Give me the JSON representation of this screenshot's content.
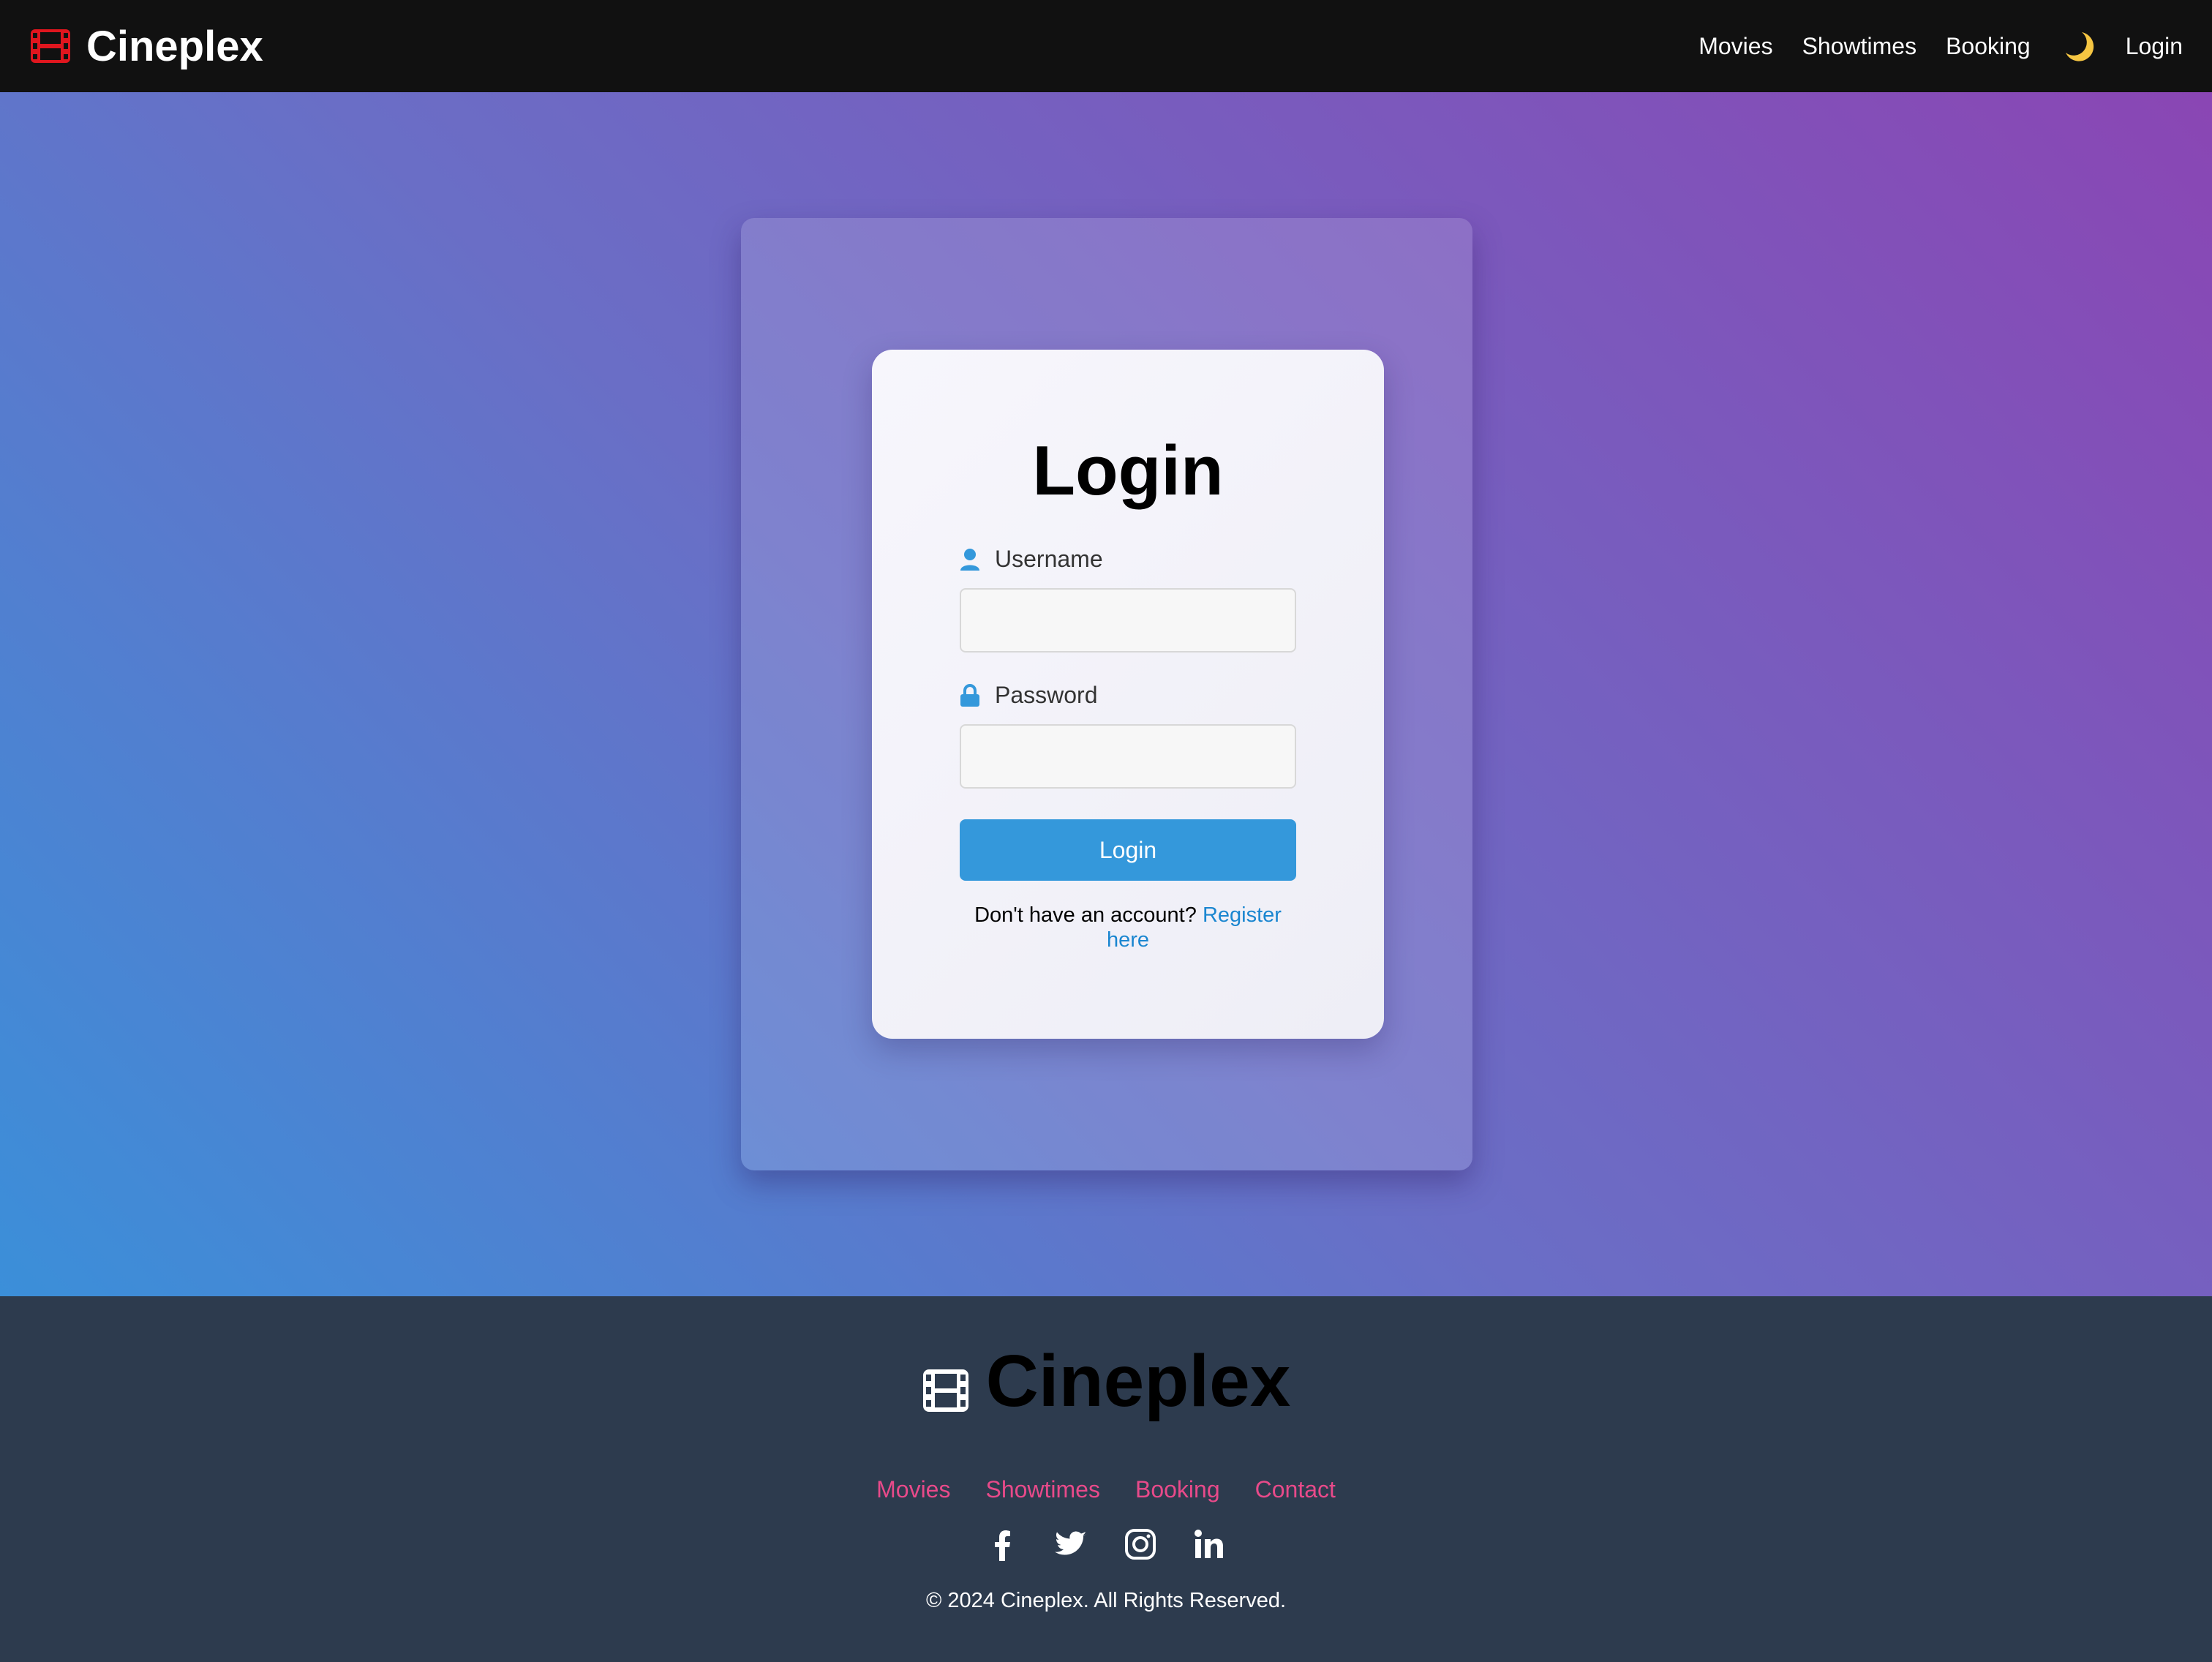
{
  "navbar": {
    "brand": "Cineplex",
    "brand_icon": "film-icon",
    "links": [
      "Movies",
      "Showtimes",
      "Booking"
    ],
    "theme_toggle_icon": "moon-icon",
    "login_link": "Login"
  },
  "login": {
    "title": "Login",
    "username_label": "Username",
    "username_icon": "user-icon",
    "username_value": "",
    "password_label": "Password",
    "password_icon": "lock-icon",
    "password_value": "",
    "button_label": "Login",
    "register_prompt": "Don't have an account?",
    "register_link": "Register here"
  },
  "footer": {
    "brand": "Cineplex",
    "brand_icon": "film-icon",
    "links": [
      "Movies",
      "Showtimes",
      "Booking",
      "Contact"
    ],
    "social_icons": [
      "facebook-icon",
      "twitter-icon",
      "instagram-icon",
      "linkedin-icon"
    ],
    "copyright": "© 2024 Cineplex. All Rights Reserved."
  },
  "colors": {
    "navbar_bg": "#111111",
    "brand_icon": "#e0161e",
    "accent_blue": "#3498db",
    "link_blue": "#1a86d0",
    "footer_bg": "#2d3b4e",
    "footer_link": "#e84a8a",
    "moon": "#f5c542"
  }
}
